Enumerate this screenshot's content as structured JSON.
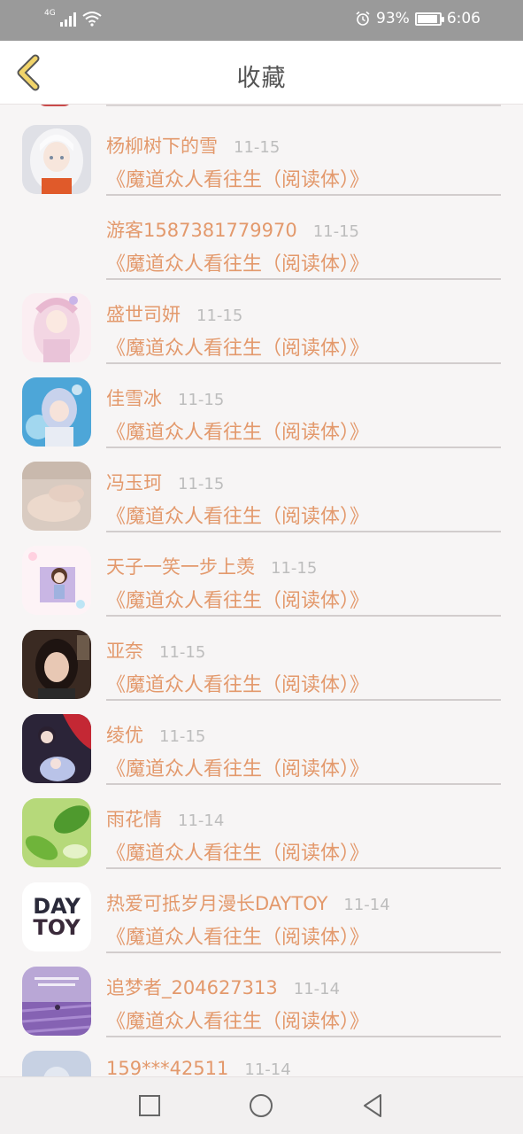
{
  "status_bar": {
    "network": "4G",
    "battery": "93%",
    "battery_level": 0.93,
    "time": "6:06",
    "icons": [
      "signal-icon",
      "wifi-icon",
      "alarm-icon",
      "battery-icon"
    ]
  },
  "header": {
    "title": "收藏",
    "back_icon": "chevron-left-icon"
  },
  "favorites": [
    {
      "name": "杨柳树下的雪",
      "date": "11-15",
      "book": "《魔道众人看往生（阅读体）》",
      "avatar": "anime-girl-white-hair"
    },
    {
      "name": "游客1587381779970",
      "date": "11-15",
      "book": "《魔道众人看往生（阅读体）》",
      "avatar": "none"
    },
    {
      "name": "盛世司妍",
      "date": "11-15",
      "book": "《魔道众人看往生（阅读体）》",
      "avatar": "anime-girl-pink"
    },
    {
      "name": "佳雪冰",
      "date": "11-15",
      "book": "《魔道众人看往生（阅读体）》",
      "avatar": "anime-girl-blue"
    },
    {
      "name": "冯玉珂",
      "date": "11-15",
      "book": "《魔道众人看往生（阅读体）》",
      "avatar": "hands-photo"
    },
    {
      "name": "天子一笑一步上羡",
      "date": "11-15",
      "book": "《魔道众人看往生（阅读体）》",
      "avatar": "chibi-girl"
    },
    {
      "name": "亚奈",
      "date": "11-15",
      "book": "《魔道众人看往生（阅读体）》",
      "avatar": "girl-photo"
    },
    {
      "name": "绫优",
      "date": "11-15",
      "book": "《魔道众人看往生（阅读体）》",
      "avatar": "anime-group"
    },
    {
      "name": "雨花情",
      "date": "11-14",
      "book": "《魔道众人看往生（阅读体）》",
      "avatar": "green-leaf"
    },
    {
      "name": "热爱可抵岁月漫长DAYTOY",
      "date": "11-14",
      "book": "《魔道众人看往生（阅读体）》",
      "avatar": "daytoy-text",
      "avatar_text": [
        "DAY",
        "TOY"
      ]
    },
    {
      "name": "追梦者_204627313",
      "date": "11-14",
      "book": "《魔道众人看往生（阅读体）》",
      "avatar": "lavender-field"
    },
    {
      "name": "159***42511",
      "date": "11-14",
      "book": "",
      "avatar": "default-silhouette"
    }
  ],
  "nav": {
    "recent_icon": "square-icon",
    "home_icon": "circle-icon",
    "back_icon": "triangle-back-icon"
  },
  "colors": {
    "accent": "#e3996c",
    "date": "#bdbdbd",
    "status_bar": "#9a9a9a",
    "back_chevron": "#f1d46a"
  }
}
